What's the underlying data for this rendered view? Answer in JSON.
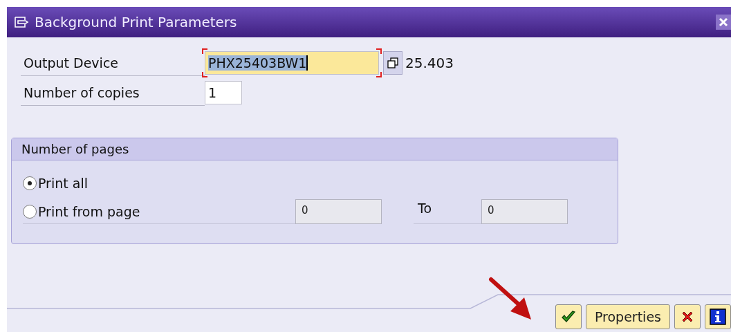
{
  "window": {
    "title": "Background Print Parameters"
  },
  "fields": [
    {
      "label": "Output Device",
      "value": "PHX25403BW1",
      "focused": true,
      "value_help": true,
      "suffix": "25.403"
    },
    {
      "label": "Number of copies",
      "value": "1",
      "focused": false,
      "value_help": false
    }
  ],
  "pages_group": {
    "title": "Number of pages",
    "options": [
      {
        "label": "Print all",
        "selected": true
      },
      {
        "label": "Print from page",
        "selected": false,
        "from": "0",
        "to_label": "To",
        "to": "0"
      }
    ]
  },
  "buttons": [
    {
      "kind": "confirm"
    },
    {
      "kind": "text",
      "label": "Properties"
    },
    {
      "kind": "cancel"
    },
    {
      "kind": "info"
    }
  ]
}
